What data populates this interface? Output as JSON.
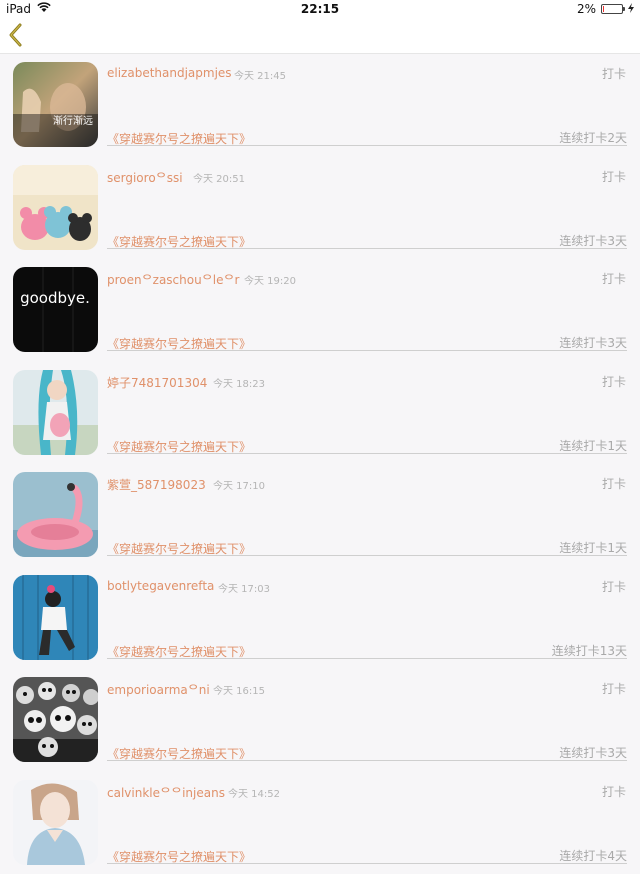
{
  "status_bar": {
    "device": "iPad",
    "time": "22:15",
    "battery": "2%"
  },
  "nav": {
    "back_icon": "chevron-left-icon"
  },
  "colors": {
    "accent": "#e0916a",
    "muted": "#a9a9a9",
    "background": "#f7f6f8"
  },
  "entries": [
    {
      "username": "elizabethandjapmjes",
      "time": "今天 21:45",
      "punch": "打卡",
      "topic": "《穿越赛尔号之撩遍天下》",
      "streak": "连续打卡2天",
      "avatar_text": "渐行渐远"
    },
    {
      "username": "sergioroᄋssi",
      "time": "今天 20:51",
      "punch": "打卡",
      "topic": "《穿越赛尔号之撩遍天下》",
      "streak": "连续打卡3天"
    },
    {
      "username": "proenᄋzaschouᄋleᄋr",
      "time": "今天 19:20",
      "punch": "打卡",
      "topic": "《穿越赛尔号之撩遍天下》",
      "streak": "连续打卡3天",
      "avatar_text": "goodbye."
    },
    {
      "username": "婷子7481701304",
      "time": "今天 18:23",
      "punch": "打卡",
      "topic": "《穿越赛尔号之撩遍天下》",
      "streak": "连续打卡1天"
    },
    {
      "username": "紫萱_587198023",
      "time": "今天 17:10",
      "punch": "打卡",
      "topic": "《穿越赛尔号之撩遍天下》",
      "streak": "连续打卡1天"
    },
    {
      "username": "botlytegavenrefta",
      "time": "今天 17:03",
      "punch": "打卡",
      "topic": "《穿越赛尔号之撩遍天下》",
      "streak": "连续打卡13天"
    },
    {
      "username": "emporioarmaᄋni",
      "time": "今天 16:15",
      "punch": "打卡",
      "topic": "《穿越赛尔号之撩遍天下》",
      "streak": "连续打卡3天"
    },
    {
      "username": "calvinkleᄋᄋinjeans",
      "time": "今天 14:52",
      "punch": "打卡",
      "topic": "《穿越赛尔号之撩遍天下》",
      "streak": "连续打卡4天"
    }
  ]
}
